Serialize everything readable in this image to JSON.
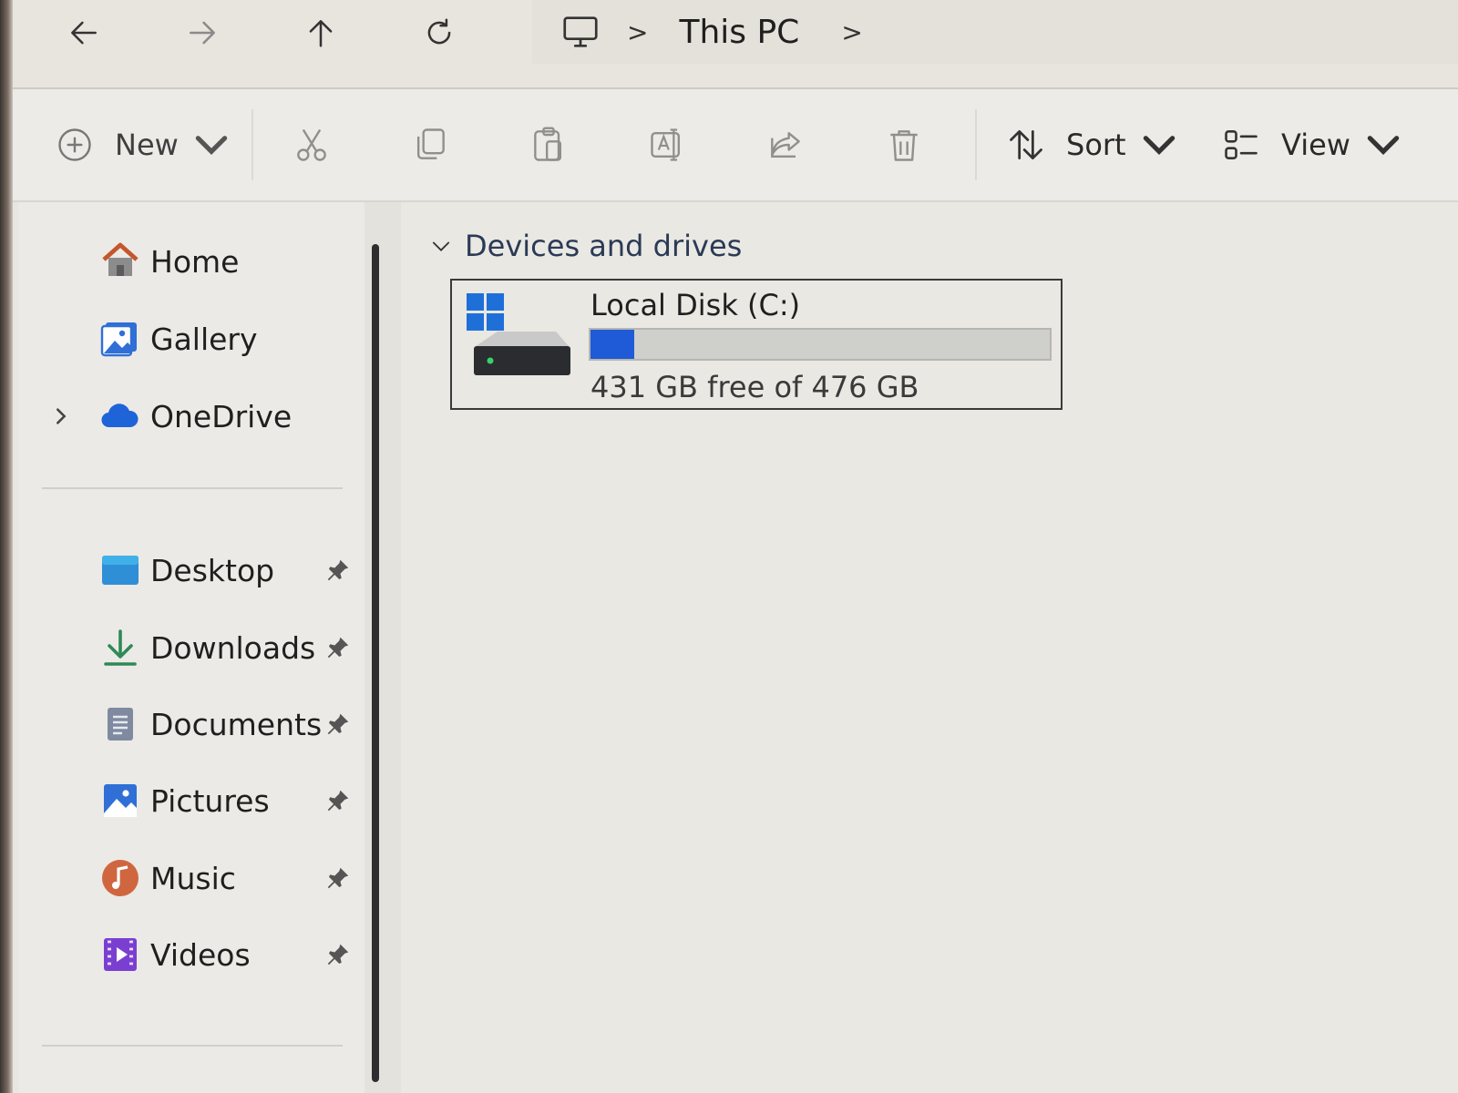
{
  "address_bar": {
    "back_icon": "arrow-left-icon",
    "forward_icon": "arrow-right-icon",
    "up_icon": "arrow-up-icon",
    "refresh_icon": "refresh-icon",
    "location_icon": "monitor-icon",
    "breadcrumb": [
      "This PC"
    ]
  },
  "toolbar": {
    "new_label": "New",
    "sort_label": "Sort",
    "view_label": "View",
    "icons": [
      "plus-circle-icon",
      "cut-icon",
      "copy-icon",
      "paste-icon",
      "rename-icon",
      "share-icon",
      "delete-icon",
      "sort-icon",
      "view-icon"
    ]
  },
  "sidebar": {
    "top_items": [
      {
        "label": "Home",
        "icon": "home-icon",
        "expandable": false
      },
      {
        "label": "Gallery",
        "icon": "gallery-icon",
        "expandable": false
      },
      {
        "label": "OneDrive",
        "icon": "onedrive-cloud-icon",
        "expandable": true
      }
    ],
    "pinned_items": [
      {
        "label": "Desktop",
        "icon": "desktop-folder-icon",
        "pinned": true
      },
      {
        "label": "Downloads",
        "icon": "downloads-icon",
        "pinned": true
      },
      {
        "label": "Documents",
        "icon": "documents-icon",
        "pinned": true
      },
      {
        "label": "Pictures",
        "icon": "pictures-icon",
        "pinned": true
      },
      {
        "label": "Music",
        "icon": "music-icon",
        "pinned": true
      },
      {
        "label": "Videos",
        "icon": "videos-icon",
        "pinned": true
      }
    ]
  },
  "content": {
    "group_title": "Devices and drives",
    "drives": [
      {
        "name": "Local Disk (C:)",
        "free_text": "431 GB free of 476 GB",
        "used_fraction": 0.095,
        "icon": "windows-drive-icon"
      }
    ]
  },
  "colors": {
    "accent": "#1f5bd6",
    "usage_bar_bg": "#cfcfcc",
    "window_bg": "#e9e8e3"
  }
}
